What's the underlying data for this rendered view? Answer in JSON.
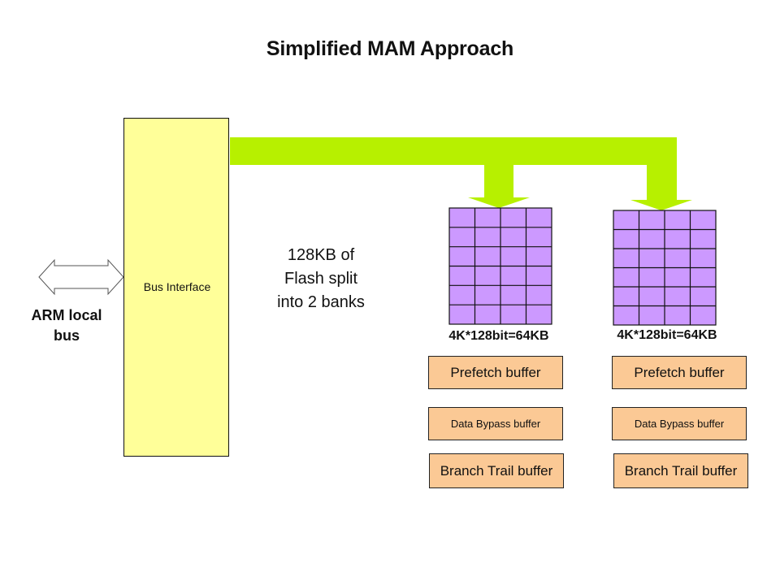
{
  "title": "Simplified MAM Approach",
  "colors": {
    "bus_interface_fill": "#ffff99",
    "bus_connector": "#b7f000",
    "flash_bank_fill": "#cc99ff",
    "buffer_fill": "#fbc995",
    "outline": "#111111"
  },
  "arm_bus": {
    "icon": "double-headed-arrow-icon",
    "label_line1": "ARM local",
    "label_line2": "bus"
  },
  "bus_interface": {
    "label": "Bus Interface"
  },
  "flash_note": {
    "line1": "128KB of",
    "line2": "Flash split",
    "line3": "into 2 banks"
  },
  "banks": [
    {
      "grid_rows": 6,
      "grid_cols": 4,
      "label": "4K*128bit=64KB",
      "buffers": [
        "Prefetch buffer",
        "Data Bypass buffer",
        "Branch Trail buffer"
      ]
    },
    {
      "grid_rows": 6,
      "grid_cols": 4,
      "label": "4K*128bit=64KB",
      "buffers": [
        "Prefetch buffer",
        "Data Bypass buffer",
        "Branch Trail buffer"
      ]
    }
  ]
}
